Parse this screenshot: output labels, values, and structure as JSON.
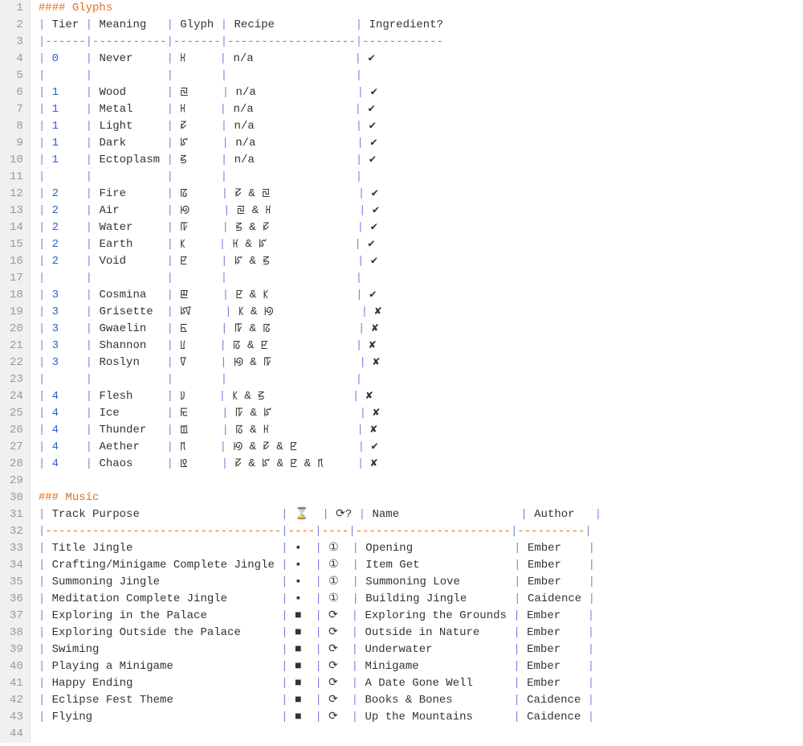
{
  "glyphs": {
    "heading": "#### Glyphs",
    "headers": [
      "Tier",
      "Meaning",
      "Glyph",
      "Recipe",
      "Ingredient?"
    ],
    "rows": [
      {
        "tier": "0",
        "meaning": "Never",
        "glyph": "ꡘ",
        "recipe": "n/a",
        "ing": "✔"
      },
      null,
      {
        "tier": "1",
        "meaning": "Wood",
        "glyph": "ꡙ",
        "recipe": "n/a",
        "ing": "✔"
      },
      {
        "tier": "1",
        "meaning": "Metal",
        "glyph": "ꡘ",
        "recipe": "n/a",
        "ing": "✔"
      },
      {
        "tier": "1",
        "meaning": "Light",
        "glyph": "ꡛ",
        "recipe": "n/a",
        "ing": "✔"
      },
      {
        "tier": "1",
        "meaning": "Dark",
        "glyph": "ꡜ",
        "recipe": "n/a",
        "ing": "✔"
      },
      {
        "tier": "1",
        "meaning": "Ectoplasm",
        "glyph": "ꡝ",
        "recipe": "n/a",
        "ing": "✔"
      },
      null,
      {
        "tier": "2",
        "meaning": "Fire",
        "glyph": "ꡞ",
        "recipe": "ꡛ & ꡙ",
        "ing": "✔"
      },
      {
        "tier": "2",
        "meaning": "Air",
        "glyph": "ꡟ",
        "recipe": "ꡙ & ꡘ",
        "ing": "✔"
      },
      {
        "tier": "2",
        "meaning": "Water",
        "glyph": "ꡠ",
        "recipe": "ꡝ & ꡛ",
        "ing": "✔"
      },
      {
        "tier": "2",
        "meaning": "Earth",
        "glyph": "ꡡ",
        "recipe": "ꡘ & ꡜ",
        "ing": "✔"
      },
      {
        "tier": "2",
        "meaning": "Void",
        "glyph": "ꡢ",
        "recipe": "ꡜ & ꡝ",
        "ing": "✔"
      },
      null,
      {
        "tier": "3",
        "meaning": "Cosmina",
        "glyph": "ꡣ",
        "recipe": "ꡢ & ꡡ",
        "ing": "✔"
      },
      {
        "tier": "3",
        "meaning": "Grisette",
        "glyph": "ꡤ",
        "recipe": "ꡡ & ꡟ",
        "ing": "✘"
      },
      {
        "tier": "3",
        "meaning": "Gwaelin",
        "glyph": "ꡥ",
        "recipe": "ꡠ & ꡞ",
        "ing": "✘"
      },
      {
        "tier": "3",
        "meaning": "Shannon",
        "glyph": "ꡦ",
        "recipe": "ꡞ & ꡢ",
        "ing": "✘"
      },
      {
        "tier": "3",
        "meaning": "Roslyn",
        "glyph": "ꡧ",
        "recipe": "ꡟ & ꡠ",
        "ing": "✘"
      },
      null,
      {
        "tier": "4",
        "meaning": "Flesh",
        "glyph": "ꡨ",
        "recipe": "ꡡ & ꡝ",
        "ing": "✘"
      },
      {
        "tier": "4",
        "meaning": "Ice",
        "glyph": "ꡩ",
        "recipe": "ꡠ & ꡜ",
        "ing": "✘"
      },
      {
        "tier": "4",
        "meaning": "Thunder",
        "glyph": "ꡪ",
        "recipe": "ꡞ & ꡘ",
        "ing": "✘"
      },
      {
        "tier": "4",
        "meaning": "Aether",
        "glyph": "ꡫ",
        "recipe": "ꡟ & ꡛ & ꡢ",
        "ing": "✔"
      },
      {
        "tier": "4",
        "meaning": "Chaos",
        "glyph": "ꡬ",
        "recipe": "ꡛ & ꡜ & ꡢ & ꡫ",
        "ing": "✘"
      }
    ]
  },
  "music": {
    "heading": "### Music",
    "headers": [
      "Track Purpose",
      "⌛",
      "⟳?",
      "Name",
      "Author"
    ],
    "rows": [
      {
        "purpose": "Title Jingle",
        "dur": "▪",
        "loop": "①",
        "name": "Opening",
        "author": "Ember"
      },
      {
        "purpose": "Crafting/Minigame Complete Jingle",
        "dur": "▪",
        "loop": "①",
        "name": "Item Get",
        "author": "Ember"
      },
      {
        "purpose": "Summoning Jingle",
        "dur": "▪",
        "loop": "①",
        "name": "Summoning Love",
        "author": "Ember"
      },
      {
        "purpose": "Meditation Complete Jingle",
        "dur": "▪",
        "loop": "①",
        "name": "Building Jingle",
        "author": "Caidence"
      },
      {
        "purpose": "Exploring in the Palace",
        "dur": "■",
        "loop": "⟳",
        "name": "Exploring the Grounds",
        "author": "Ember"
      },
      {
        "purpose": "Exploring Outside the Palace",
        "dur": "■",
        "loop": "⟳",
        "name": "Outside in Nature",
        "author": "Ember"
      },
      {
        "purpose": "Swiming",
        "dur": "■",
        "loop": "⟳",
        "name": "Underwater",
        "author": "Ember"
      },
      {
        "purpose": "Playing a Minigame",
        "dur": "■",
        "loop": "⟳",
        "name": "Minigame",
        "author": "Ember"
      },
      {
        "purpose": "Happy Ending",
        "dur": "■",
        "loop": "⟳",
        "name": "A Date Gone Well",
        "author": "Ember"
      },
      {
        "purpose": "Eclipse Fest Theme",
        "dur": "■",
        "loop": "⟳",
        "name": "Books & Bones",
        "author": "Caidence"
      },
      {
        "purpose": "Flying",
        "dur": "■",
        "loop": "⟳",
        "name": "Up the Mountains",
        "author": "Caidence"
      }
    ]
  },
  "widths": {
    "glyphs": {
      "tier": 5,
      "meaning": 10,
      "glyph": 6,
      "recipe": 18
    },
    "music": {
      "purpose": 34,
      "dur": 3,
      "loop": 3,
      "name": 22,
      "author": 9
    }
  },
  "line_count": 44
}
